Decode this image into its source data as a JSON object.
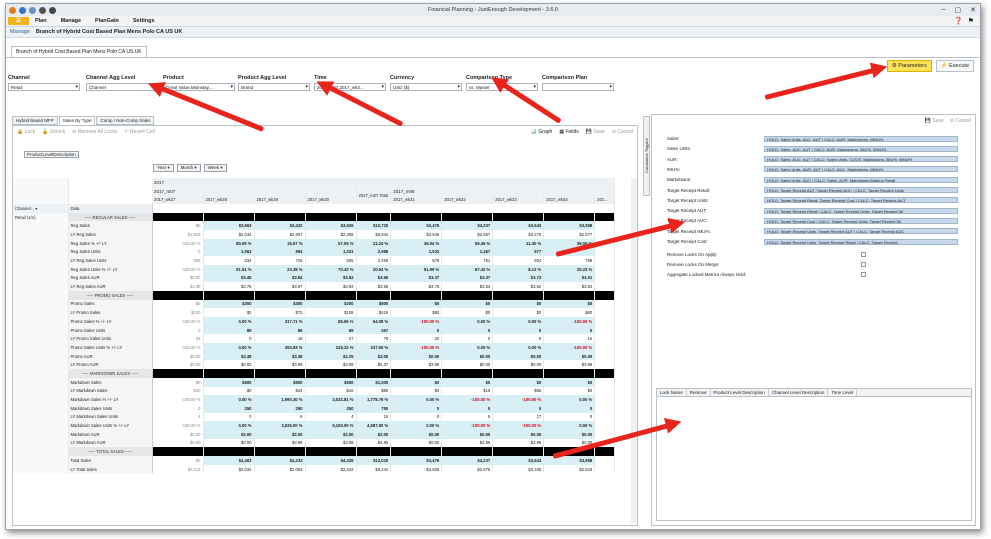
{
  "window": {
    "title": "Financial Planning - JustEnough Development - 3.6.0"
  },
  "menu": {
    "items": [
      "Plan",
      "Manage",
      "PlanGate",
      "Settings"
    ]
  },
  "crumb": {
    "manage": "Manage",
    "path": "Branch of Hybrid Cost Based Plan Mens Polo CA US UK"
  },
  "doc_tab": "Branch of Hybrid Cost Based Plan Mens Polo CA US UK",
  "toolbar": {
    "parameters": "Parameters",
    "execute": "Execute"
  },
  "filters": [
    {
      "label": "Channel",
      "value": "Retail"
    },
    {
      "label": "Channel Agg Level",
      "value": "Channel"
    },
    {
      "label": "Product",
      "value": "Great Value,Mainstay,..."
    },
    {
      "label": "Product Agg Level",
      "value": "Brand"
    },
    {
      "label": "Time",
      "value": "2017_m07,2017_wk2..."
    },
    {
      "label": "Currency",
      "value": "USD ($)"
    },
    {
      "label": "Comparison Type",
      "value": "vs. Master"
    },
    {
      "label": "Comparison Plan",
      "value": ""
    }
  ],
  "subtabs": [
    "Hybrid Based MFP",
    "Sales By Type",
    "Comp / Non-Comp Sales"
  ],
  "left_tools": {
    "lock": "Lock",
    "unlock": "Unlock",
    "remove_all": "Remove All Locks",
    "revert": "Revert Cell",
    "graph": "Graph",
    "fields": "Fields",
    "save": "Save",
    "cancel": "Cancel"
  },
  "grid": {
    "pld_label": "ProductLevelDescription",
    "hdr_buttons": [
      "Year",
      "Month",
      "Week"
    ],
    "year": "2017",
    "month": "2017_m07",
    "month2": "2017_m08",
    "channel_hdr": "Channel...",
    "data_hdr": "Data",
    "channel_value": "Retail (1/1)",
    "columns": [
      "2017_wk27",
      "2017_wk28",
      "2017_wk29",
      "2017_wk30",
      "2017_m07 Total",
      "2017_wk31",
      "2017_wk32",
      "2017_wk33",
      "2017_wk34",
      "201..."
    ],
    "rows": [
      {
        "label": "----- REGULAR SALES -----",
        "sec": true,
        "cells": []
      },
      {
        "label": "Reg Sales",
        "cells": [
          "$0",
          "$3,663",
          "$3,432",
          "$3,626",
          "$10,720",
          "$3,476",
          "$4,237",
          "$3,643",
          "$3,558"
        ],
        "bold": true
      },
      {
        "label": "LY Reg Sales",
        "cells": [
          "$1,933",
          "$2,034",
          "$2,967",
          "$2,308",
          "$8,842",
          "$3,546",
          "$2,657",
          "$3,270",
          "$2,577"
        ]
      },
      {
        "label": "Reg Sales % +/- LY",
        "cells": [
          "-100.00 %",
          "80.09 %",
          "15.67 %",
          "57.09 %",
          "21.24 %",
          "36.54 %",
          "59.46 %",
          "11.40 %",
          "38.05 %"
        ],
        "bold": true
      },
      {
        "label": "Reg Sales Units",
        "cells": [
          "0",
          "1,063",
          "894",
          "1,031",
          "2,986",
          "1,032",
          "1,257",
          "977",
          ""
        ],
        "bold": true
      },
      {
        "label": "LY Reg Sales Units",
        "cells": [
          "565",
          "534",
          "725",
          "605",
          "2,469",
          "679",
          "751",
          "604",
          "758"
        ]
      },
      {
        "label": "Reg Sales Units % +/- LY",
        "cells": [
          "-100.00 %",
          "91.51 %",
          "23.38 %",
          "70.43 %",
          "20.94 %",
          "51.99 %",
          "67.42 %",
          "8.12 %",
          "25.33 %"
        ],
        "bold": true
      },
      {
        "label": "Reg Sales AUR",
        "cells": [
          "$0.00",
          "$3.45",
          "$3.84",
          "$3.52",
          "$3.59",
          "$3.37",
          "$3.37",
          "$3.73",
          "$4.01"
        ],
        "bold": true
      },
      {
        "label": "LY Reg Sales AUR",
        "cells": [
          "$3.39",
          "$3.75",
          "$3.67",
          "$3.94",
          "$3.58",
          "$3.75",
          "$3.54",
          "$3.62",
          "$3.64"
        ]
      },
      {
        "label": "----- PROMO SALES -----",
        "sec": true,
        "cells": []
      },
      {
        "label": "Promo Sales",
        "cells": [
          "$0",
          "$300",
          "$300",
          "$200",
          "$800",
          "$0",
          "$0",
          "$0",
          "$0"
        ],
        "bold": true
      },
      {
        "label": "LY Promo Sales",
        "cells": [
          "$240",
          "$0",
          "$72",
          "$108",
          "$419",
          "$80",
          "$0",
          "$0",
          "$60"
        ]
      },
      {
        "label": "Promo Sales % +/- LY",
        "cells": [
          "-100.00 %",
          "0.00 %",
          "317.71 %",
          "85.65 %",
          "54.08 %",
          "-100.00 %",
          "0.00 %",
          "0.00 %",
          "-100.00 %"
        ],
        "bold": true
      },
      {
        "label": "Promo Sales Units",
        "cells": [
          "0",
          "89",
          "89",
          "89",
          "267",
          "0",
          "0",
          "0",
          "0"
        ],
        "bold": true
      },
      {
        "label": "LY Promo Sales Units",
        "cells": [
          "34",
          "0",
          "18",
          "27",
          "79",
          "20",
          "0",
          "0",
          "15"
        ]
      },
      {
        "label": "Promo Sales Units % +/- LY",
        "cells": [
          "-100.00 %",
          "0.00 %",
          "393.83 %",
          "229.22 %",
          "237.55 %",
          "-100.00 %",
          "0.00 %",
          "0.00 %",
          "-100.00 %"
        ],
        "bold": true
      },
      {
        "label": "Promo AUR",
        "cells": [
          "$0.00",
          "$3.38",
          "$3.38",
          "$2.25",
          "$3.00",
          "$0.00",
          "$0.00",
          "$0.00",
          "$0.00"
        ],
        "bold": true
      },
      {
        "label": "LY Promo AUR",
        "cells": [
          "$0.00",
          "$0.00",
          "$3.99",
          "$3.99",
          "$5.37",
          "$3.99",
          "$0.00",
          "$0.00",
          "$3.99"
        ]
      },
      {
        "label": "----- MARKDOWN SALES -----",
        "sec": true,
        "cells": []
      },
      {
        "label": "Markdown Sales",
        "cells": [
          "$0",
          "$500",
          "$500",
          "$500",
          "$1,500",
          "$0",
          "$0",
          "$0",
          "$0"
        ],
        "bold": true
      },
      {
        "label": "LY Markdown Sales",
        "cells": [
          "$40",
          "$0",
          "$24",
          "$16",
          "$80",
          "$0",
          "$19",
          "$65",
          "$0"
        ]
      },
      {
        "label": "Markdown Sales % +/- LY",
        "cells": [
          "-100.00 %",
          "0.00 %",
          "1,990.30 %",
          "3,032.81 %",
          "1,778.76 %",
          "0.00 %",
          "-100.00 %",
          "-100.00 %",
          "0.00 %"
        ],
        "bold": true
      },
      {
        "label": "Markdown Sales Units",
        "cells": [
          "0",
          "250",
          "250",
          "250",
          "750",
          "0",
          "0",
          "0",
          "0"
        ],
        "bold": true
      },
      {
        "label": "LY Markdown Sales Units",
        "cells": [
          "4",
          "0",
          "6",
          "4",
          "16",
          "0",
          "5",
          "17",
          "0"
        ]
      },
      {
        "label": "Markdown Sales Units % +/- LY",
        "cells": [
          "-100.00 %",
          "0.00 %",
          "3,025.00 %",
          "6,150.00 %",
          "4,587.50 %",
          "0.00 %",
          "-100.00 %",
          "-100.00 %",
          "0.00 %"
        ],
        "bold": true
      },
      {
        "label": "Markdown AUR",
        "cells": [
          "$0.00",
          "$2.00",
          "$2.00",
          "$2.00",
          "$2.00",
          "$0.00",
          "$0.00",
          "$0.00",
          "$0.00"
        ],
        "bold": true
      },
      {
        "label": "LY Markdown AUR",
        "cells": [
          "$0.00",
          "$0.00",
          "$3.99",
          "$3.99",
          "$4.95",
          "$0.00",
          "$3.99",
          "$3.99",
          "$0.00"
        ]
      },
      {
        "label": "----- TOTAL SALES -----",
        "sec": true,
        "cells": []
      },
      {
        "label": "Total Sales",
        "cells": [
          "$0",
          "$4,463",
          "$4,232",
          "$4,326",
          "$13,020",
          "$3,476",
          "$4,237",
          "$3,643",
          "$3,558"
        ],
        "bold": true
      },
      {
        "label": "LY Total Sales",
        "cells": [
          "$2,212",
          "$2,034",
          "$2,063",
          "$2,432",
          "$9,441",
          "$3,626",
          "$2,676",
          "$3,335",
          "$2,643"
        ]
      }
    ]
  },
  "right_panel": {
    "vtab": "Calculation Toggles",
    "save": "Save",
    "cancel": "Cancel",
    "params": [
      {
        "label": "Sales:",
        "value": "HOLD: Sales Units, AUC, AUT | CALC: AUR, Markdowns, MMU%"
      },
      {
        "label": "Sales Units:",
        "value": "HOLD: Sales, AUC, AUT | CALC: AUR, Markdowns, IMU%, MMU%"
      },
      {
        "label": "AUR:",
        "value": "HOLD: Sales, AUC, AUT | CALC: Sales Units, COGS, Markdowns, IMU%, MMU%"
      },
      {
        "label": "IMU%:",
        "value": "HOLD: Sales Units, AUR, AUT | CALC: AUC, Markdowns, MMU%"
      },
      {
        "label": "Markdowns:",
        "value": "HOLD: Sales Units, AUC | CALC: Sales, AUR, Maintained Markup Retail"
      },
      {
        "label": "Target Receipt Retail:",
        "value": "HOLD: Target Receipt AUT, Target Receipt AUC | CALC: Target Receipt Units"
      },
      {
        "label": "Target Receipt Units:",
        "value": "HOLD: Target Receipt Retail, Target Receipt Cost | CALC: Target Receipt AUT"
      },
      {
        "label": "Target Receipt AUT:",
        "value": "HOLD: Target Receipt Retail | CALC: Target Receipt Units, Target Receipt IM"
      },
      {
        "label": "Target Receipt AUC:",
        "value": "HOLD: Target Receipt Cost | CALC: Target Receipt Units, Target Receipt IM"
      },
      {
        "label": "Target Receipt IMU%:",
        "value": "HOLD: Target Receipt Units, Target Receipt AUT | CALC: Target Receipt AUC"
      },
      {
        "label": "Target Receipt Cost:",
        "value": "HOLD: Target Receipt Units, Target Receipt Retail | CALC: Target Receipt"
      }
    ],
    "checks": [
      "Remove Locks On Apply:",
      "Remove Locks On Merge:",
      "Aggregate Locked Metrics Always Hold:"
    ],
    "lock_cols": [
      "Lock Name",
      "Remove",
      "Product Level Description",
      "Channel Level Description",
      "Time Level"
    ]
  },
  "colors": {
    "accent": "#f3b21b",
    "arrow": "#e8241c",
    "highlight": "#d8eff5",
    "negative": "#d0021b"
  }
}
